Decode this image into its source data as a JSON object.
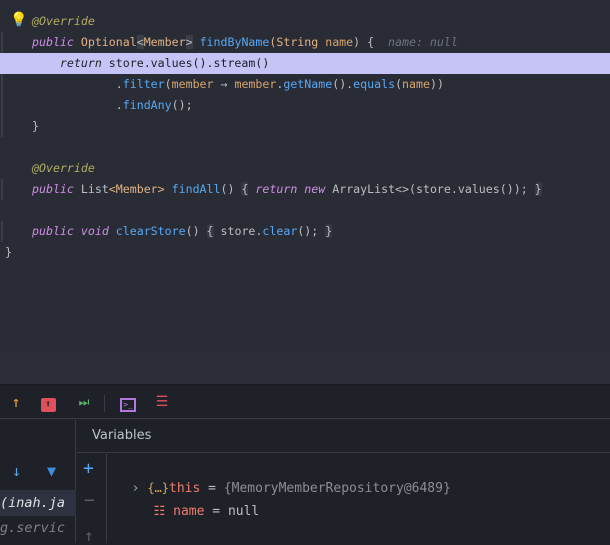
{
  "editor": {
    "lines": [
      {
        "row": 0,
        "indent": false,
        "tokens": [
          {
            "t": "@Override",
            "c": "ann"
          }
        ]
      },
      {
        "row": 1,
        "indent": true,
        "tokens": [
          {
            "t": "public",
            "c": "kw"
          },
          {
            "t": " Optional",
            "c": "ty"
          },
          {
            "t": "<",
            "c": "gen"
          },
          {
            "t": "Member",
            "c": "ty"
          },
          {
            "t": ">",
            "c": "gen"
          },
          {
            "t": " "
          },
          {
            "t": "findByName",
            "c": "fn"
          },
          {
            "t": "(String ",
            "c": "ty"
          },
          {
            "t": "name",
            "c": "pm"
          },
          {
            "t": ") {"
          },
          {
            "t": "  name: null",
            "c": "hint"
          }
        ]
      },
      {
        "row": 2,
        "indent": false,
        "hl": true,
        "tokens": [
          {
            "t": "    "
          },
          {
            "t": "return",
            "c": "kw"
          },
          {
            "t": " store.values().stream()"
          }
        ]
      },
      {
        "row": 3,
        "indent": true,
        "tokens": [
          {
            "t": "            ."
          },
          {
            "t": "filter",
            "c": "mc"
          },
          {
            "t": "("
          },
          {
            "t": "member",
            "c": "pm"
          },
          {
            "t": " → "
          },
          {
            "t": "member",
            "c": "pm"
          },
          {
            "t": "."
          },
          {
            "t": "getName",
            "c": "mc"
          },
          {
            "t": "()."
          },
          {
            "t": "equals",
            "c": "mc"
          },
          {
            "t": "("
          },
          {
            "t": "name",
            "c": "pm"
          },
          {
            "t": "))"
          }
        ]
      },
      {
        "row": 4,
        "indent": true,
        "tokens": [
          {
            "t": "            ."
          },
          {
            "t": "findAny",
            "c": "mc"
          },
          {
            "t": "();"
          }
        ]
      },
      {
        "row": 5,
        "indent": true,
        "tokens": [
          {
            "t": "}"
          }
        ]
      },
      {
        "row": 7,
        "indent": false,
        "tokens": [
          {
            "t": "@Override",
            "c": "ann"
          }
        ]
      },
      {
        "row": 8,
        "indent": true,
        "tokens": [
          {
            "t": "public",
            "c": "kw"
          },
          {
            "t": " List"
          },
          {
            "t": "<Member>",
            "c": "ty"
          },
          {
            "t": " "
          },
          {
            "t": "findAll",
            "c": "fn"
          },
          {
            "t": "() "
          },
          {
            "t": "{",
            "c": "fold"
          },
          {
            "t": " "
          },
          {
            "t": "return",
            "c": "kw"
          },
          {
            "t": " "
          },
          {
            "t": "new",
            "c": "kw"
          },
          {
            "t": " ArrayList<>(store.values()); "
          },
          {
            "t": "}",
            "c": "fold"
          }
        ]
      },
      {
        "row": 10,
        "indent": true,
        "tokens": [
          {
            "t": "public",
            "c": "kw"
          },
          {
            "t": " "
          },
          {
            "t": "void",
            "c": "kw"
          },
          {
            "t": " "
          },
          {
            "t": "clearStore",
            "c": "fn"
          },
          {
            "t": "() "
          },
          {
            "t": "{",
            "c": "fold"
          },
          {
            "t": " store."
          },
          {
            "t": "clear",
            "c": "mc"
          },
          {
            "t": "(); "
          },
          {
            "t": "}",
            "c": "fold"
          }
        ]
      },
      {
        "row": 11,
        "indent": false,
        "tokens": [
          {
            "t": "}",
            "x": true
          }
        ]
      }
    ]
  },
  "variables": {
    "title": "Variables",
    "items": [
      {
        "name": "this",
        "eq": " = ",
        "value": "{MemoryMemberRepository@6489}"
      },
      {
        "name": "name",
        "eq": " = ",
        "value": "null"
      }
    ]
  },
  "frames": {
    "line1": "(inah.ja",
    "line2": "g.servic"
  },
  "colors": {
    "highlight": "#c6c4f7",
    "var_name": "#ef7d6e",
    "bg": "#1f2128"
  }
}
